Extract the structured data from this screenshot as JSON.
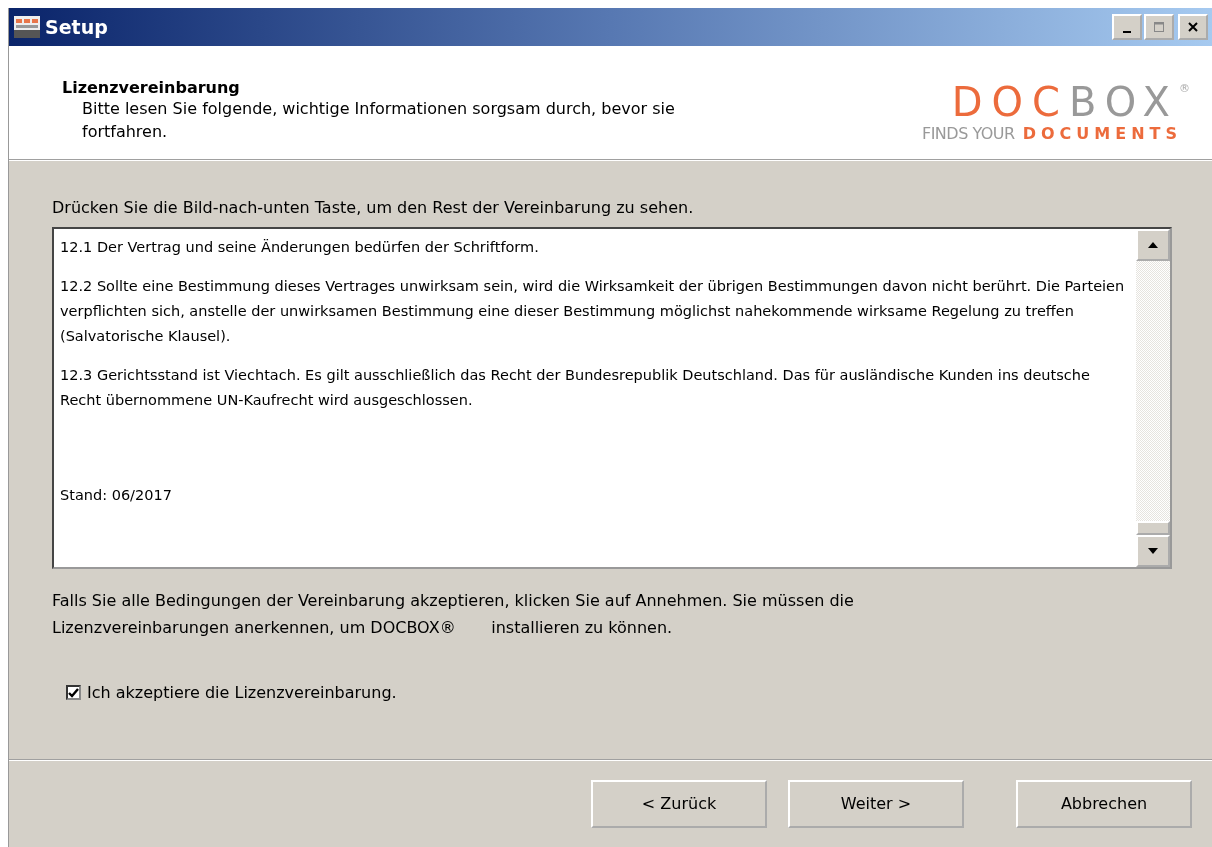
{
  "window": {
    "title": "Setup"
  },
  "header": {
    "title": "Lizenzvereinbarung",
    "subtitle": "Bitte lesen Sie folgende, wichtige Informationen sorgsam durch, bevor sie fortfahren.",
    "logo": {
      "word_1": "DOC",
      "word_2": "BOX",
      "mark": "®",
      "tagline_1": "FINDS YOUR",
      "tagline_2": "DOCUMENTS"
    }
  },
  "instruction": "Drücken Sie die Bild-nach-unten Taste, um den Rest der Vereinbarung zu sehen.",
  "license_text": [
    "12.1 Der Vertrag und seine Änderungen bedürfen der Schriftform.",
    "12.2 Sollte eine Bestimmung dieses Vertrages unwirksam sein, wird die Wirksamkeit der übrigen Bestimmungen davon nicht berührt. Die Parteien verpflichten sich, anstelle der unwirksamen Bestimmung eine dieser Bestimmung möglichst nahekommende wirksame Regelung zu treffen (Salvatorische Klausel).",
    "12.3 Gerichtsstand ist Viechtach. Es gilt ausschließlich das Recht der Bundesrepublik Deutschland. Das für ausländische Kunden ins deutsche Recht übernommene UN-Kaufrecht wird ausgeschlossen.",
    "Stand: 06/2017"
  ],
  "note": "Falls Sie alle Bedingungen der Vereinbarung akzeptieren, klicken Sie auf Annehmen. Sie müssen die Lizenzvereinbarungen anerkennen, um DOCBOX®       installieren zu können.",
  "accept": {
    "label": "Ich akzeptiere die Lizenzvereinbarung.",
    "checked": true
  },
  "buttons": [
    "< Zurück",
    "Weiter >",
    "Abbrechen"
  ]
}
